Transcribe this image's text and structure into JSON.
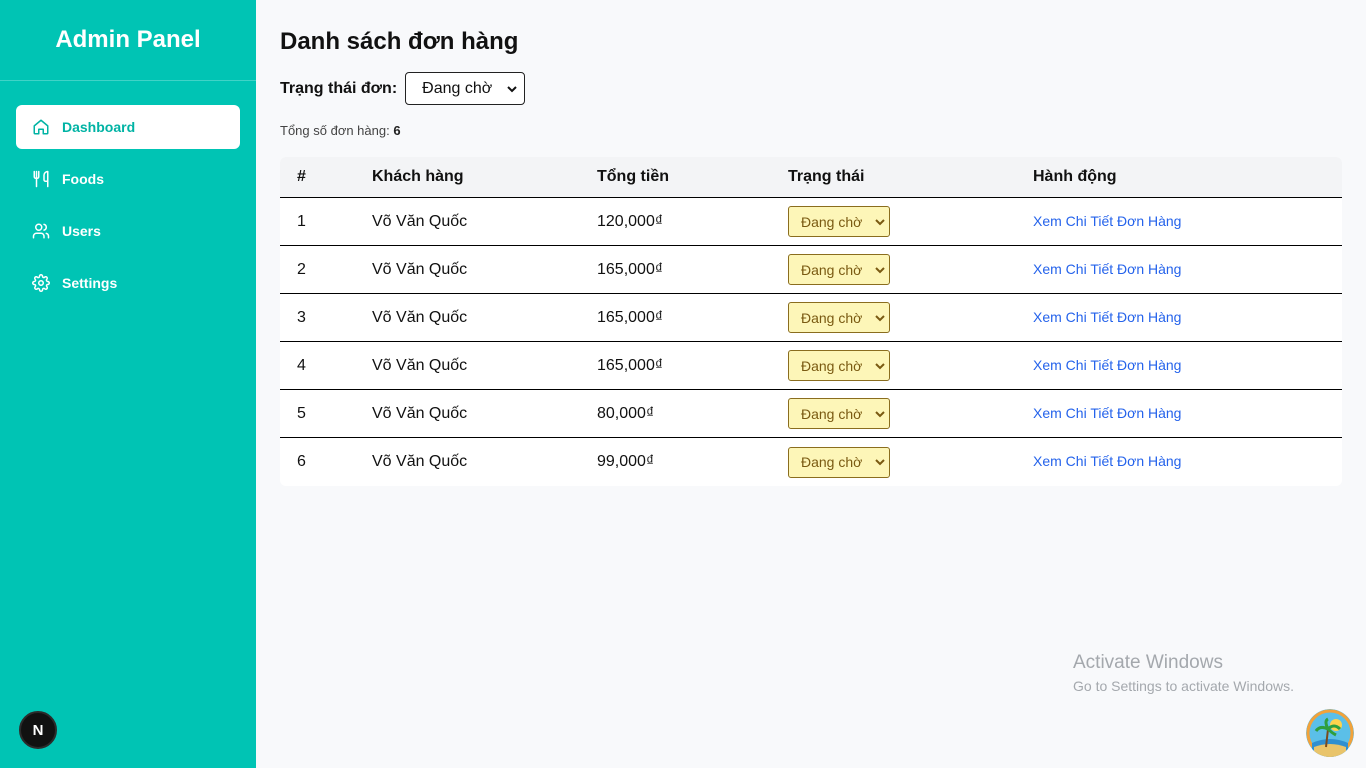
{
  "sidebar": {
    "brand": "Admin Panel",
    "items": [
      {
        "label": "Dashboard",
        "icon": "home-icon",
        "active": true
      },
      {
        "label": "Foods",
        "icon": "utensils-icon",
        "active": false
      },
      {
        "label": "Users",
        "icon": "users-icon",
        "active": false
      },
      {
        "label": "Settings",
        "icon": "gear-icon",
        "active": false
      }
    ],
    "badge": "N"
  },
  "main": {
    "title": "Danh sách đơn hàng",
    "filter_label": "Trạng thái đơn:",
    "filter_value": "Đang chờ",
    "total_label": "Tổng số đơn hàng:",
    "total_value": "6"
  },
  "table": {
    "headers": [
      "#",
      "Khách hàng",
      "Tổng tiền",
      "Trạng thái",
      "Hành động"
    ],
    "rows": [
      {
        "id": "1",
        "customer": "Võ Văn Quốc",
        "total": "120,000₫",
        "status": "Đang chờ",
        "action": "Xem Chi Tiết Đơn Hàng"
      },
      {
        "id": "2",
        "customer": "Võ Văn Quốc",
        "total": "165,000₫",
        "status": "Đang chờ",
        "action": "Xem Chi Tiết Đơn Hàng"
      },
      {
        "id": "3",
        "customer": "Võ Văn Quốc",
        "total": "165,000₫",
        "status": "Đang chờ",
        "action": "Xem Chi Tiết Đơn Hàng"
      },
      {
        "id": "4",
        "customer": "Võ Văn Quốc",
        "total": "165,000₫",
        "status": "Đang chờ",
        "action": "Xem Chi Tiết Đơn Hàng"
      },
      {
        "id": "5",
        "customer": "Võ Văn Quốc",
        "total": "80,000₫",
        "status": "Đang chờ",
        "action": "Xem Chi Tiết Đơn Hàng"
      },
      {
        "id": "6",
        "customer": "Võ Văn Quốc",
        "total": "99,000₫",
        "status": "Đang chờ",
        "action": "Xem Chi Tiết Đơn Hàng"
      }
    ]
  },
  "watermark": {
    "line1": "Activate Windows",
    "line2": "Go to Settings to activate Windows."
  },
  "colors": {
    "sidebar": "#00c4b4",
    "accent": "#00b3a4",
    "link": "#2563eb",
    "status_bg": "#fdf6b8"
  }
}
